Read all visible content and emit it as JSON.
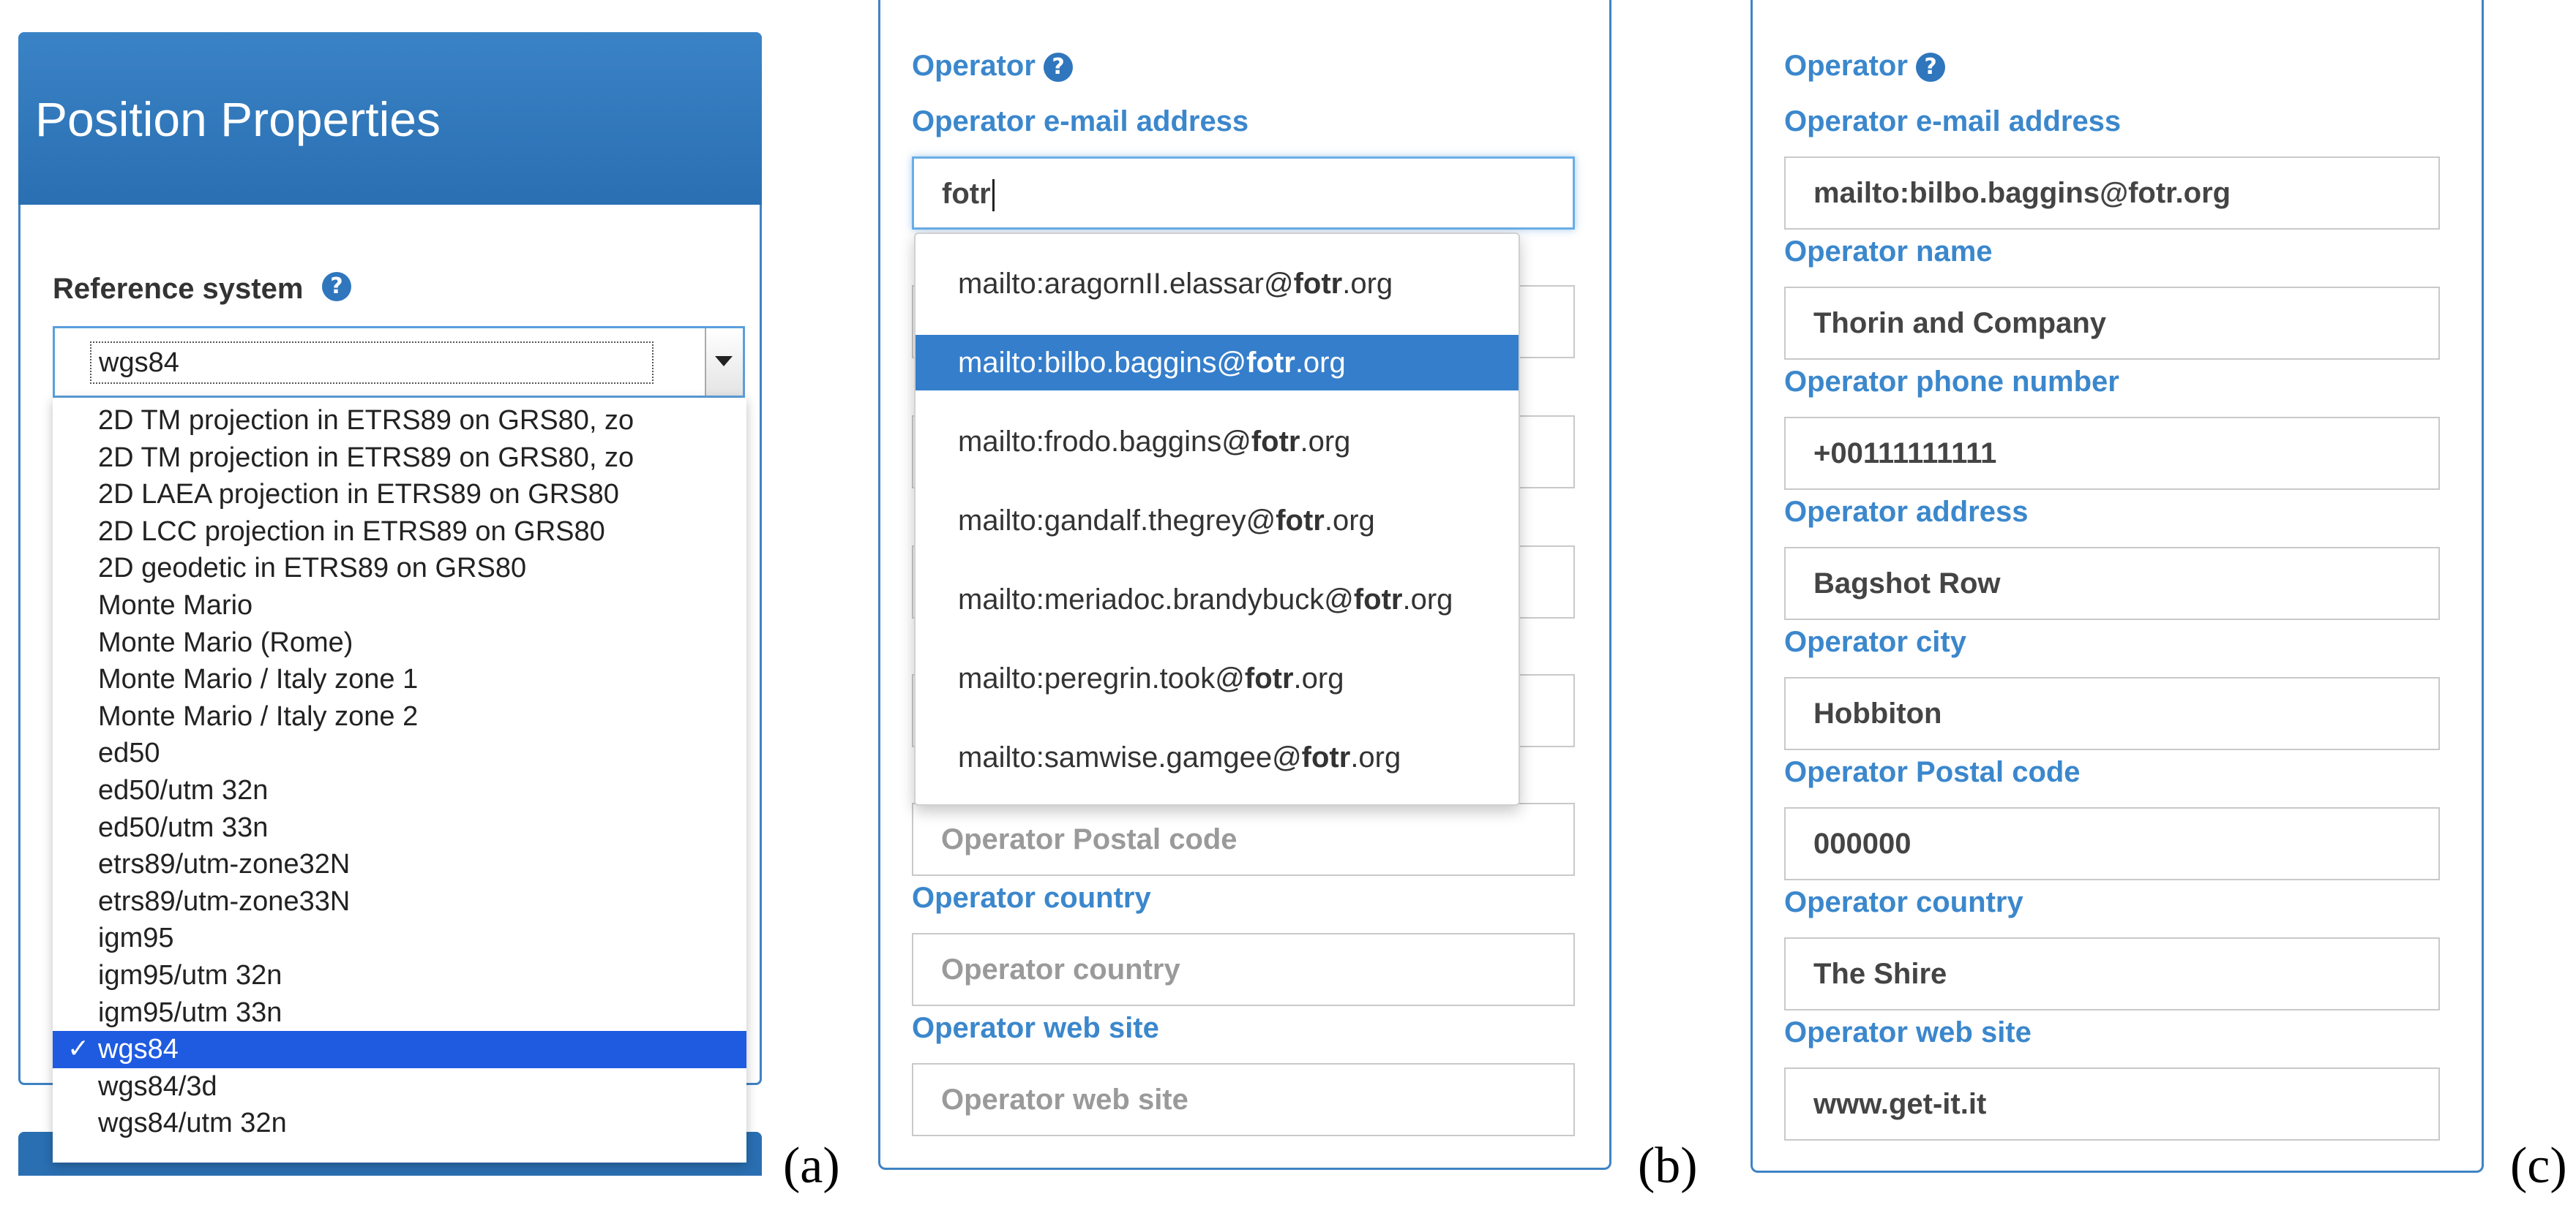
{
  "panel_a": {
    "title": "Position Properties",
    "reference_system_label": "Reference system",
    "help_glyph": "?",
    "selected_value": "wgs84",
    "check_glyph": "✓",
    "options": [
      {
        "label": "2D TM projection in ETRS89 on GRS80, zo"
      },
      {
        "label": "2D TM projection in ETRS89 on GRS80, zo"
      },
      {
        "label": "2D LAEA projection in ETRS89 on GRS80"
      },
      {
        "label": "2D LCC projection in ETRS89 on GRS80"
      },
      {
        "label": "2D geodetic in ETRS89 on GRS80"
      },
      {
        "label": "Monte Mario"
      },
      {
        "label": "Monte Mario (Rome)"
      },
      {
        "label": "Monte Mario / Italy zone 1"
      },
      {
        "label": "Monte Mario / Italy zone 2"
      },
      {
        "label": "ed50"
      },
      {
        "label": "ed50/utm 32n"
      },
      {
        "label": "ed50/utm 33n"
      },
      {
        "label": "etrs89/utm-zone32N"
      },
      {
        "label": "etrs89/utm-zone33N"
      },
      {
        "label": "igm95"
      },
      {
        "label": "igm95/utm 32n"
      },
      {
        "label": "igm95/utm 33n"
      },
      {
        "label": "wgs84",
        "selected": true
      },
      {
        "label": "wgs84/3d"
      },
      {
        "label": "wgs84/utm 32n"
      }
    ],
    "panel_label": "(a)",
    "icons": {
      "help": "question-circle-icon",
      "dropdown": "chevron-down-icon",
      "check": "check-icon"
    },
    "colors": {
      "header": "#2f76bd",
      "selected_option": "#1f5be0",
      "label": "#3b87cc"
    }
  },
  "panel_b": {
    "operator_label": "Operator",
    "help_glyph": "?",
    "email_label": "Operator e-mail address",
    "email_value": "fotr",
    "autocomplete": [
      {
        "prefix": "mailto:aragornII.elassar@",
        "match": "fotr",
        "suffix": ".org"
      },
      {
        "prefix": "mailto:bilbo.baggins@",
        "match": "fotr",
        "suffix": ".org",
        "active": true
      },
      {
        "prefix": "mailto:frodo.baggins@",
        "match": "fotr",
        "suffix": ".org"
      },
      {
        "prefix": "mailto:gandalf.thegrey@",
        "match": "fotr",
        "suffix": ".org"
      },
      {
        "prefix": "mailto:meriadoc.brandybuck@",
        "match": "fotr",
        "suffix": ".org"
      },
      {
        "prefix": "mailto:peregrin.took@",
        "match": "fotr",
        "suffix": ".org"
      },
      {
        "prefix": "mailto:samwise.gamgee@",
        "match": "fotr",
        "suffix": ".org"
      }
    ],
    "postal_placeholder": "Operator Postal code",
    "country_label": "Operator country",
    "country_placeholder": "Operator country",
    "website_label": "Operator web site",
    "website_placeholder": "Operator web site",
    "panel_label": "(b)"
  },
  "panel_c": {
    "operator_label": "Operator",
    "help_glyph": "?",
    "fields": [
      {
        "label": "Operator e-mail address",
        "value": "mailto:bilbo.baggins@fotr.org"
      },
      {
        "label": "Operator name",
        "value": "Thorin and Company"
      },
      {
        "label": "Operator phone number",
        "value": "+00111111111"
      },
      {
        "label": "Operator address",
        "value": "Bagshot Row"
      },
      {
        "label": "Operator city",
        "value": "Hobbiton"
      },
      {
        "label": "Operator Postal code",
        "value": "000000"
      },
      {
        "label": "Operator country",
        "value": "The Shire"
      },
      {
        "label": "Operator web site",
        "value": "www.get-it.it"
      }
    ],
    "panel_label": "(c)"
  }
}
